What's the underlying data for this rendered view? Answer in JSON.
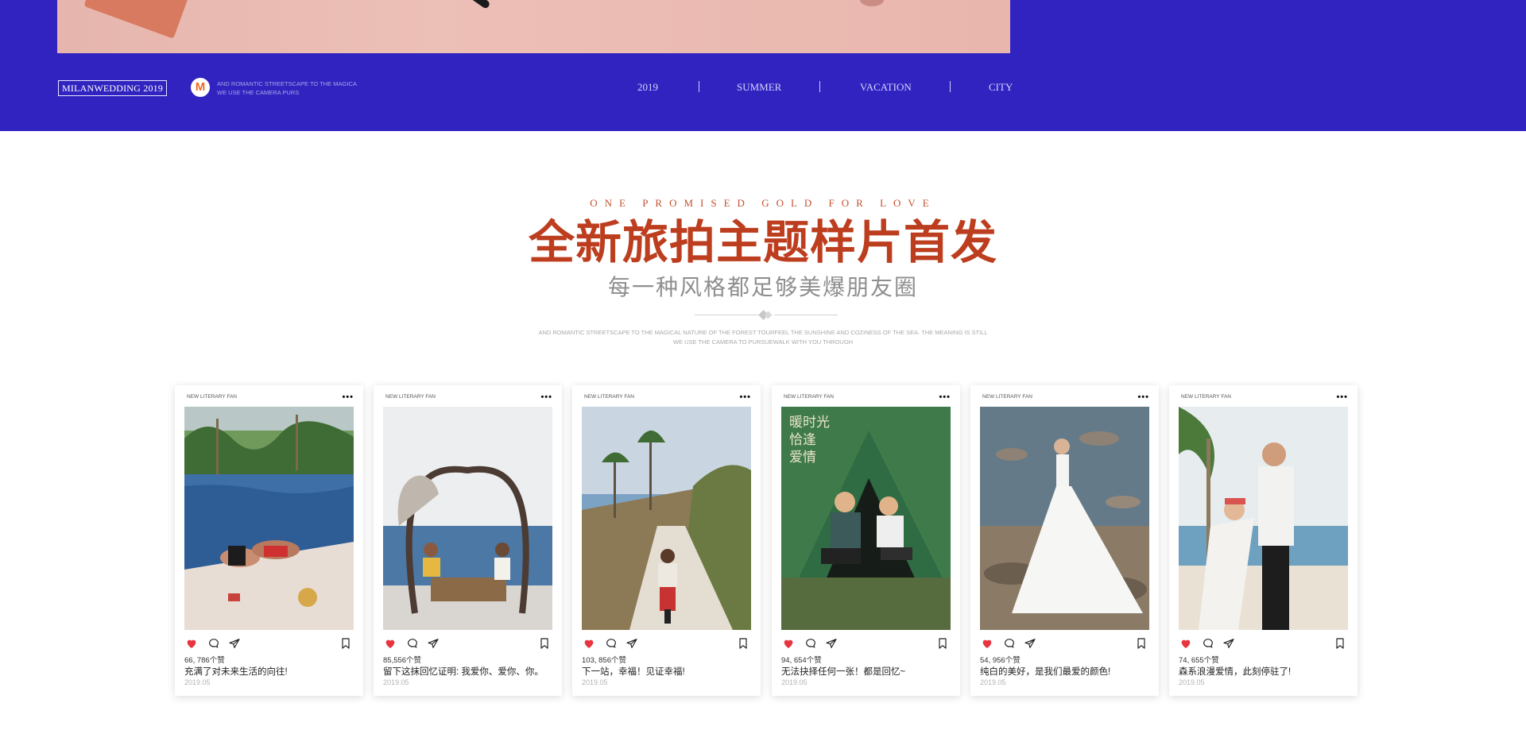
{
  "hero": {
    "brand": "MILANWEDDING 2019",
    "logo_letter": "M",
    "tagline": [
      "AND ROMANTIC STREETSCAPE TO THE MAGICA",
      "WE USE THE CAMERA  PURS"
    ],
    "nav": [
      "2019",
      "SUMMER",
      "VACATION",
      "CITY"
    ]
  },
  "section": {
    "kicker": "ONE PROMISED GOLD FOR LOVE",
    "title": "全新旅拍主题样片首发",
    "subtitle": "每一种风格都足够美爆朋友圈",
    "description": [
      "AND ROMANTIC STREETSCAPE TO THE MAGICAL NATURE OF THE FOREST TOURFEEL THE SUNSHINE AND COZINESS OF THE SEA. THE MEANING IS STILL",
      "WE USE THE CAMERA TO PURSUEWALK WITH YOU THROUGH"
    ]
  },
  "accent_color": "#bd3e1f",
  "hero_color": "#3023bf",
  "cards": [
    {
      "user": "NEW LITERARY FAN",
      "likes": "66, 786个赞",
      "caption": "充满了对未来生活的向往!",
      "date": "2019.05",
      "photo_icon": "pool-couple-photo"
    },
    {
      "user": "NEW LITERARY FAN",
      "likes": "85,556个赞",
      "caption": "留下这抹回忆证明: 我爱你、爱你、你。",
      "date": "2019.05",
      "photo_icon": "beach-swing-photo"
    },
    {
      "user": "NEW LITERARY FAN",
      "likes": "103, 856个赞",
      "caption": "下一站，幸福！见证幸福!",
      "date": "2019.05",
      "photo_icon": "scooter-road-photo"
    },
    {
      "user": "NEW LITERARY FAN",
      "likes": "94, 654个赞",
      "caption": "无法抉择任何一张！都是回忆~",
      "date": "2019.05",
      "photo_icon": "tent-picnic-photo"
    },
    {
      "user": "NEW LITERARY FAN",
      "likes": "54, 956个赞",
      "caption": "纯白的美好，是我们最爱的颜色!",
      "date": "2019.05",
      "photo_icon": "rocky-shore-bride-photo"
    },
    {
      "user": "NEW LITERARY FAN",
      "likes": "74, 655个赞",
      "caption": "森系浪漫爱情，此刻停驻了!",
      "date": "2019.05",
      "photo_icon": "palm-couple-photo"
    }
  ],
  "card4_photo_text": [
    "暖时光",
    "恰逢",
    "爱情"
  ]
}
